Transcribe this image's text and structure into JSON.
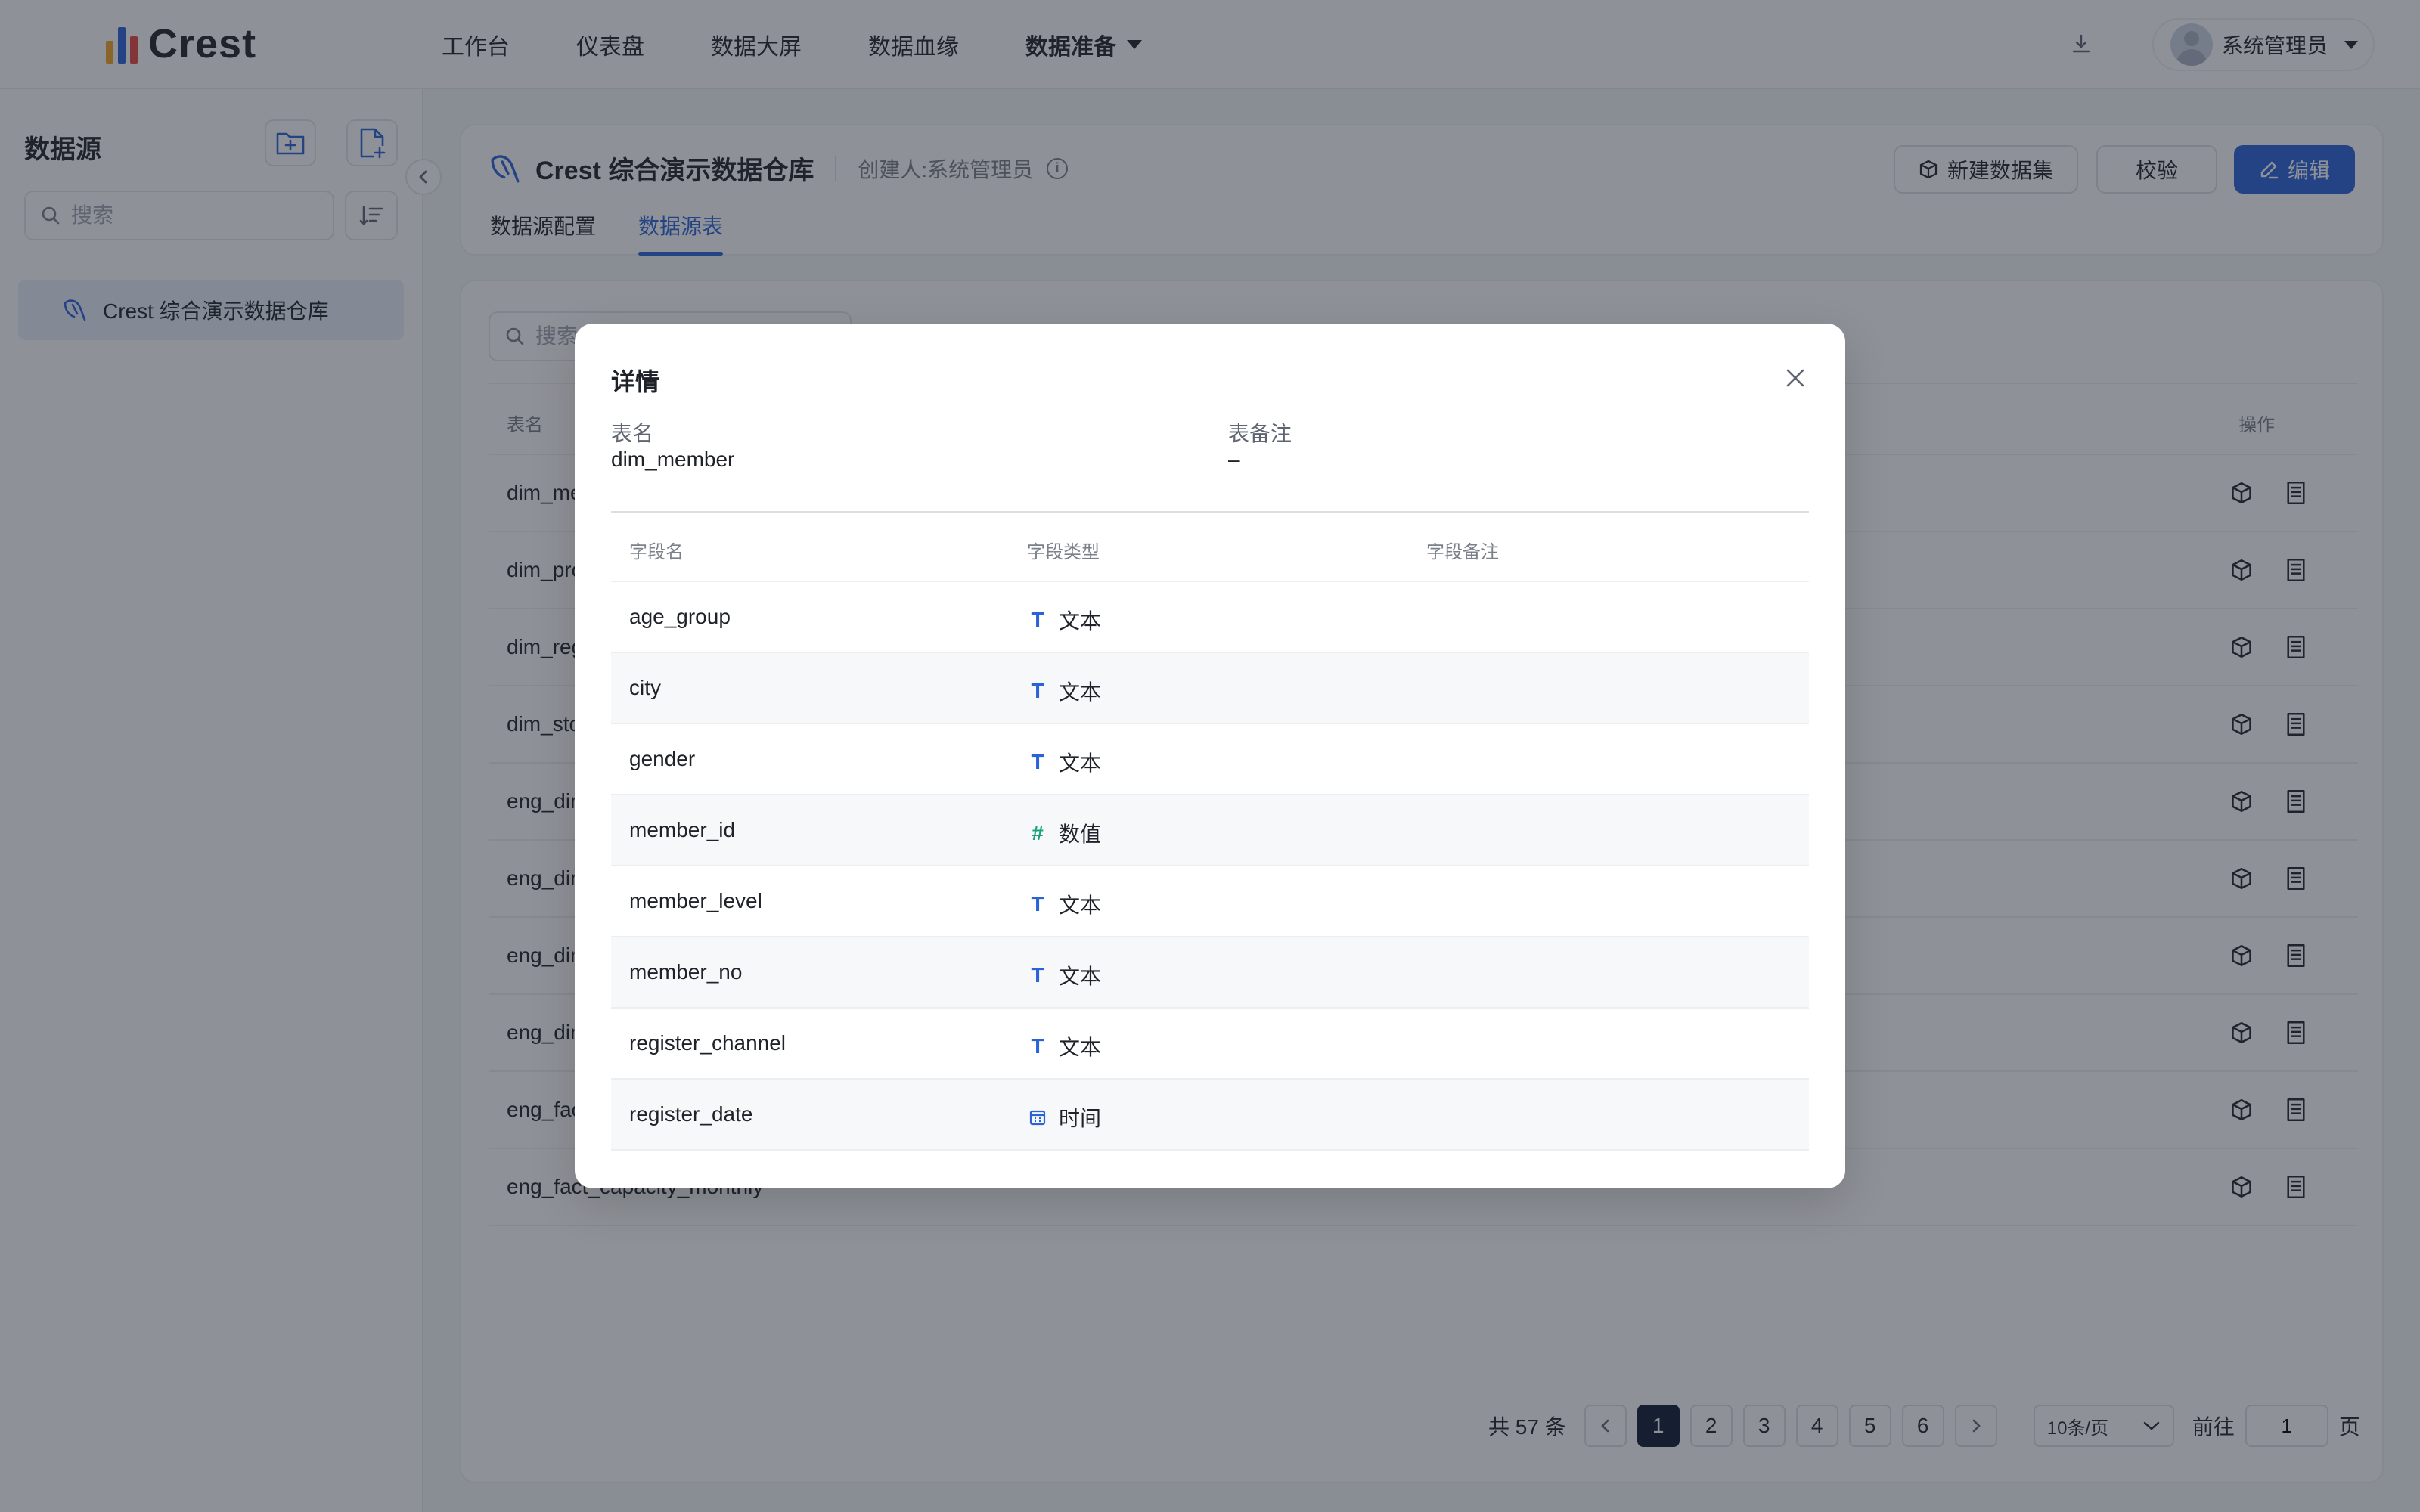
{
  "app": {
    "logo_text": "Crest",
    "logo_colors": [
      "#f5a623",
      "#2a63d8",
      "#e8453c"
    ],
    "accent": "#2a63d8"
  },
  "nav": {
    "items": [
      "工作台",
      "仪表盘",
      "数据大屏",
      "数据血缘",
      "数据准备"
    ],
    "active_index": 4
  },
  "user": {
    "name": "系统管理员"
  },
  "sidebar": {
    "title": "数据源",
    "search_placeholder": "搜索",
    "items": [
      {
        "label": "Crest 综合演示数据仓库",
        "icon": "database-icon"
      }
    ]
  },
  "datasource": {
    "name": "Crest 综合演示数据仓库",
    "creator": "创建人:系统管理员",
    "tabs": [
      "数据源配置",
      "数据源表"
    ],
    "active_tab": 1,
    "buttons": {
      "new_dataset": "新建数据集",
      "validate": "校验",
      "edit": "编辑"
    }
  },
  "table": {
    "search_placeholder": "搜索",
    "headers": {
      "name": "表名",
      "actions": "操作"
    },
    "rows": [
      "dim_member",
      "dim_product",
      "dim_region",
      "dim_store",
      "eng_dim_a",
      "eng_dim_b",
      "eng_dim_c",
      "eng_dim_d",
      "eng_fact_a",
      "eng_fact_capacity_monthly"
    ]
  },
  "pagination": {
    "total": "共 57 条",
    "pages": [
      "1",
      "2",
      "3",
      "4",
      "5",
      "6"
    ],
    "current": "1",
    "page_size": "10条/页",
    "goto_label": "前往",
    "goto_value": "1",
    "page_suffix": "页"
  },
  "modal": {
    "title": "详情",
    "table_name_label": "表名",
    "table_name": "dim_member",
    "remark_label": "表备注",
    "remark": "–",
    "columns": {
      "field": "字段名",
      "type": "字段类型",
      "remark": "字段备注"
    },
    "fields": [
      {
        "name": "age_group",
        "type": "文本",
        "icon": "T",
        "icon_color": "#2a63d8"
      },
      {
        "name": "city",
        "type": "文本",
        "icon": "T",
        "icon_color": "#2a63d8"
      },
      {
        "name": "gender",
        "type": "文本",
        "icon": "T",
        "icon_color": "#2a63d8"
      },
      {
        "name": "member_id",
        "type": "数值",
        "icon": "#",
        "icon_color": "#16a37a"
      },
      {
        "name": "member_level",
        "type": "文本",
        "icon": "T",
        "icon_color": "#2a63d8"
      },
      {
        "name": "member_no",
        "type": "文本",
        "icon": "T",
        "icon_color": "#2a63d8"
      },
      {
        "name": "register_channel",
        "type": "文本",
        "icon": "T",
        "icon_color": "#2a63d8"
      },
      {
        "name": "register_date",
        "type": "时间",
        "icon": "calendar-icon",
        "icon_color": "#2a63d8"
      }
    ]
  }
}
